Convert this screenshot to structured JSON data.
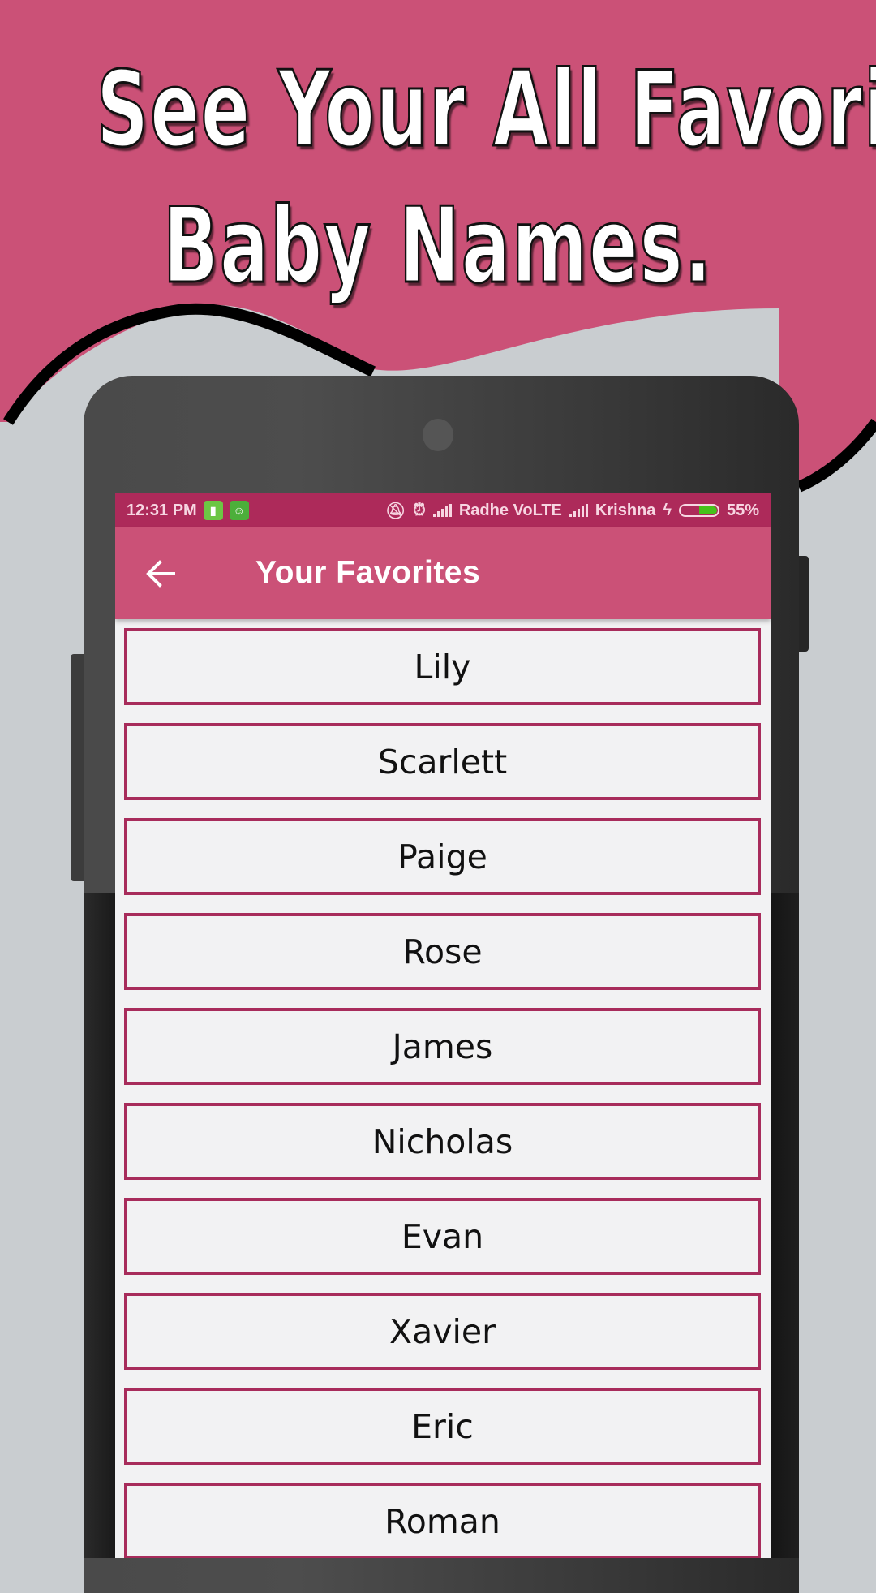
{
  "promo": {
    "headline_line1": "See Your All Favorite",
    "headline_line2": "Baby Names.",
    "brand_color": "#cb5177",
    "background_color": "#c9cdd0"
  },
  "status_bar": {
    "time": "12:31 PM",
    "notification_icons": [
      "battery-saver-icon",
      "android-app-icon"
    ],
    "silent_icon": "silent-bell-icon",
    "alarm_icon": "alarm-clock-icon",
    "carrier1": "Radhe VoLTE",
    "carrier2": "Krishna",
    "charging_icon": "lightning-icon",
    "battery_percent_label": "55%",
    "battery_level": 0.55,
    "background_color": "#ad2a5a"
  },
  "app_bar": {
    "back_icon": "arrow-left-icon",
    "title": "Your Favorites"
  },
  "favorites": [
    {
      "name": "Lily"
    },
    {
      "name": "Scarlett"
    },
    {
      "name": "Paige"
    },
    {
      "name": "Rose"
    },
    {
      "name": "James"
    },
    {
      "name": "Nicholas"
    },
    {
      "name": "Evan"
    },
    {
      "name": "Xavier"
    },
    {
      "name": "Eric"
    },
    {
      "name": "Roman"
    }
  ]
}
